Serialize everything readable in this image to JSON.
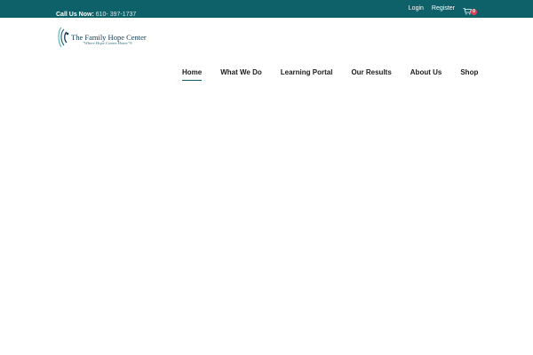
{
  "topbar": {
    "call_label": "Call Us Now:",
    "phone": "610- 397-1737",
    "login": "Login",
    "register": "Register",
    "cart_count": "0",
    "background": "#0f6169"
  },
  "logo": {
    "name": "The Family Hope Center",
    "tagline": "\"Where Hope Comes Home\"®"
  },
  "nav": {
    "items": [
      "Home",
      "What We Do",
      "Learning Portal",
      "Our Results",
      "About Us",
      "Shop"
    ],
    "active": "Home",
    "accent": "#0f6169"
  }
}
